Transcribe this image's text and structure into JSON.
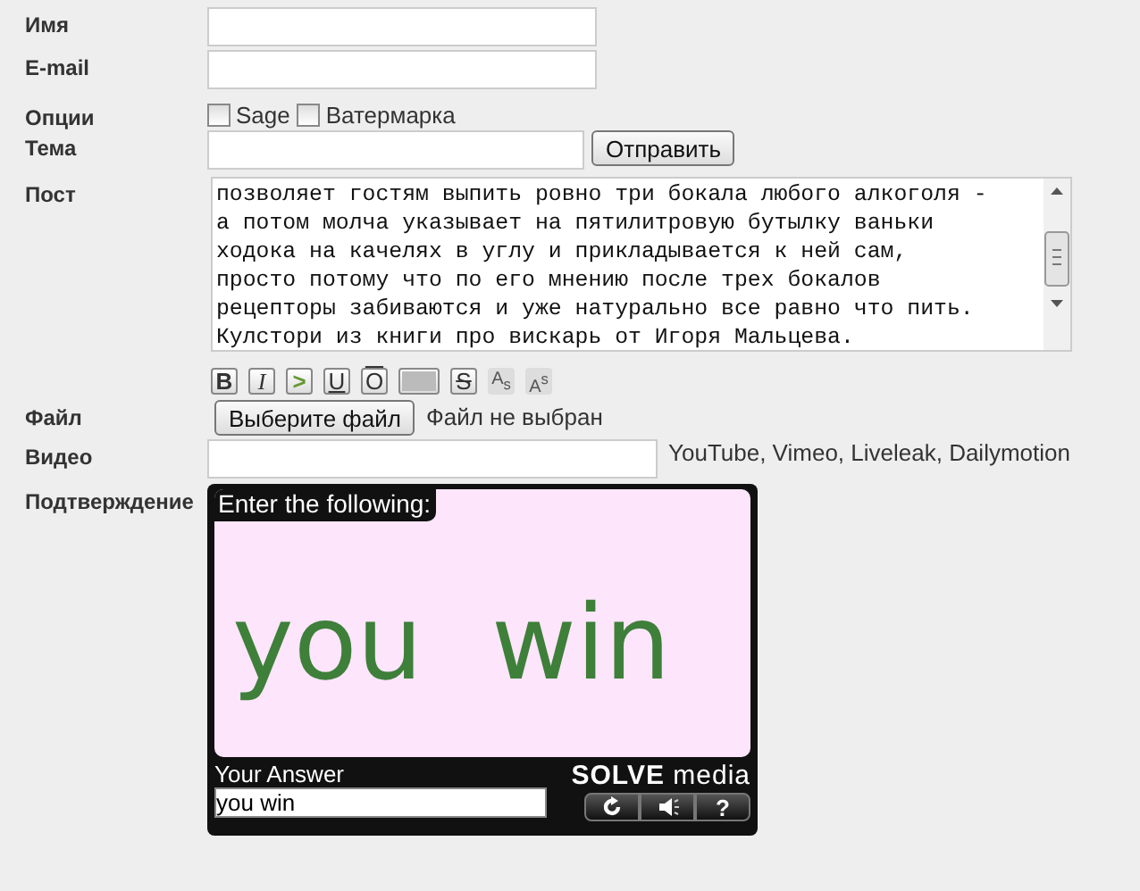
{
  "fields": [
    {
      "label": "Имя",
      "kind": "input"
    },
    {
      "label": "E-mail",
      "kind": "input"
    }
  ],
  "options": {
    "label": "Опции",
    "items": [
      {
        "label": "Sage",
        "checked": false
      },
      {
        "label": "Ватермарка",
        "checked": false
      }
    ]
  },
  "subject": {
    "label": "Тема",
    "button": "Отправить"
  },
  "post": {
    "label": "Пост",
    "lines": [
      "позволяет гостям выпить ровно три бокала любого алкоголя -",
      "а потом молча указывает на пятилитровую бутылку ваньки",
      "ходока на качелях в углу и прикладывается к ней сам,",
      "просто потому что по его мнению после трех бокалов",
      "рецепторы забиваются и уже натурально все равно что пить.",
      "Кулстори из книги про вискарь от Игоря Мальцева."
    ]
  },
  "toolbar": [
    {
      "kind": "bold",
      "label": "B"
    },
    {
      "kind": "italic",
      "label": "I"
    },
    {
      "kind": "quote",
      "label": ">"
    },
    {
      "kind": "underline",
      "label": "U"
    },
    {
      "kind": "overline",
      "label": "O"
    },
    {
      "kind": "spoiler"
    },
    {
      "kind": "strike",
      "label": "S"
    },
    {
      "kind": "small",
      "label": "A$_{s}$"
    },
    {
      "kind": "small",
      "label": "A$^{s}$"
    }
  ],
  "file": {
    "label": "Файл",
    "button": "Выберите файл",
    "status": "Файл не выбран"
  },
  "video": {
    "label": "Видео",
    "hint": "YouTube, Vimeo, Liveleak, Dailymotion"
  },
  "captcha": {
    "label": "Подтверждение",
    "prompt": "Enter the following:",
    "challenge": "you win",
    "answer_label": "Your Answer",
    "answer": "you win",
    "logo_bold": "SOLVE",
    "logo": "media",
    "help": "?"
  }
}
